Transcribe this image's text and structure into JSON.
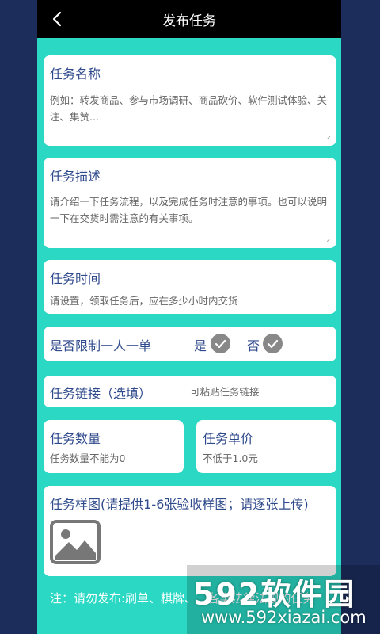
{
  "header": {
    "title": "发布任务"
  },
  "task_name": {
    "label": "任务名称",
    "placeholder": "例如：转发商品、参与市场调研、商品砍价、软件测试体验、关注、集赞..."
  },
  "task_desc": {
    "label": "任务描述",
    "placeholder": "请介绍一下任务流程，以及完成任务时注意的事项。也可以说明一下在交货时需注意的有关事项。"
  },
  "task_time": {
    "label": "任务时间",
    "placeholder": "请设置，领取任务后，应在多少小时内交货"
  },
  "limit": {
    "label": "是否限制一人一单",
    "yes": "是",
    "no": "否"
  },
  "task_link": {
    "label": "任务链接（选填）",
    "placeholder": "可粘贴任务链接"
  },
  "task_qty": {
    "label": "任务数量",
    "placeholder": "任务数量不能为0"
  },
  "task_price": {
    "label": "任务单价",
    "placeholder": "不低于1.0元"
  },
  "sample": {
    "label": "任务样图(请提供1-6张验收样图；请逐张上传)"
  },
  "note": {
    "text": "注：请勿发布:刷单、棋牌、...各类法律法规的任务"
  },
  "watermark": {
    "brand": "592软件园",
    "url": "www.592xiazai.com"
  }
}
